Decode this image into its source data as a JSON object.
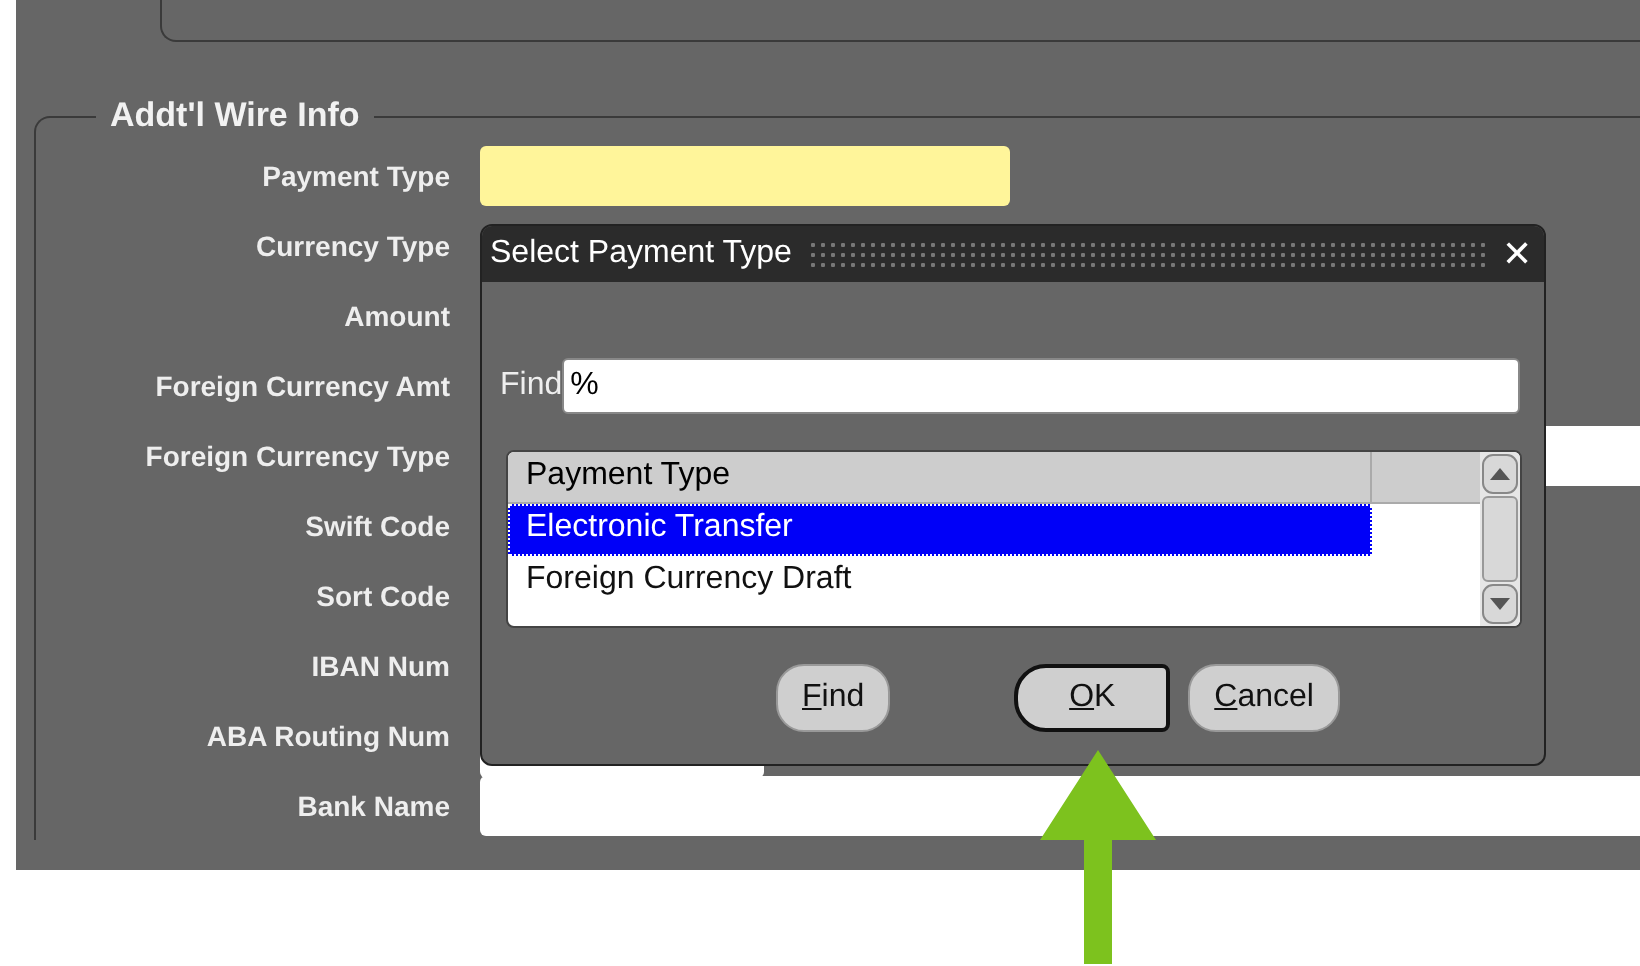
{
  "section": {
    "title": "Addt'l Wire Info"
  },
  "rows": [
    {
      "label": "Payment Type",
      "kind": "required"
    },
    {
      "label": "Currency Type"
    },
    {
      "label": "Amount"
    },
    {
      "label": "Foreign Currency Amt"
    },
    {
      "label": "Foreign Currency Type",
      "kind": "wide"
    },
    {
      "label": "Swift Code"
    },
    {
      "label": "Sort Code"
    },
    {
      "label": "IBAN Num"
    },
    {
      "label": "ABA Routing Num",
      "kind": "short"
    },
    {
      "label": "Bank Name",
      "kind": "wide"
    }
  ],
  "dialog": {
    "title": "Select Payment Type",
    "close": "✕",
    "find_label": "Find",
    "find_value": "%",
    "list": {
      "column": "Payment Type",
      "items": [
        {
          "label": "Electronic Transfer",
          "selected": true
        },
        {
          "label": "Foreign Currency Draft",
          "selected": false
        }
      ]
    },
    "buttons": [
      {
        "key": "F",
        "rest": "ind",
        "default": false
      },
      {
        "key": "O",
        "rest": "K",
        "default": true
      },
      {
        "key": "C",
        "rest": "ancel",
        "default": false
      }
    ]
  }
}
